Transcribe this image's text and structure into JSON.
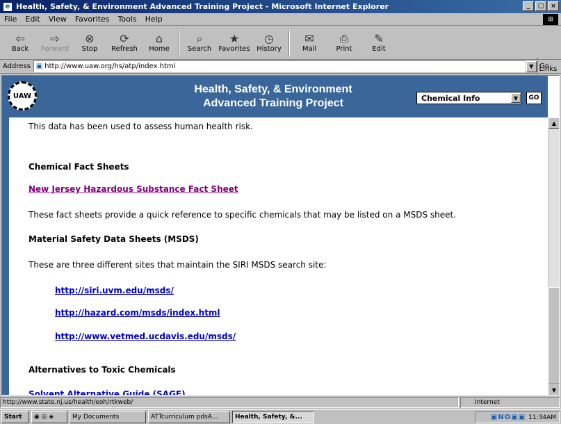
{
  "window": {
    "title": "Health, Safety, & Environment Advanced Training Project - Microsoft Internet Explorer",
    "buttons": [
      "_",
      "□",
      "×"
    ]
  },
  "menu": [
    "File",
    "Edit",
    "View",
    "Favorites",
    "Tools",
    "Help"
  ],
  "toolbar": [
    {
      "label": "Back",
      "icon": "back-arrow-icon",
      "glyph": "⇦"
    },
    {
      "label": "Forward",
      "icon": "forward-arrow-icon",
      "glyph": "⇨"
    },
    {
      "label": "Stop",
      "icon": "stop-icon",
      "glyph": "⊗"
    },
    {
      "label": "Refresh",
      "icon": "refresh-icon",
      "glyph": "⟳"
    },
    {
      "label": "Home",
      "icon": "home-icon",
      "glyph": "⌂"
    },
    {
      "label": "Search",
      "icon": "search-icon",
      "glyph": "⌕"
    },
    {
      "label": "Favorites",
      "icon": "favorites-icon",
      "glyph": "★"
    },
    {
      "label": "History",
      "icon": "history-icon",
      "glyph": "◷"
    },
    {
      "label": "Mail",
      "icon": "mail-icon",
      "glyph": "✉"
    },
    {
      "label": "Print",
      "icon": "print-icon",
      "glyph": "⎙"
    },
    {
      "label": "Edit",
      "icon": "edit-icon",
      "glyph": "✎"
    }
  ],
  "links_label": "Links",
  "address": {
    "label": "Address",
    "url": "http://www.uaw.org/hs/atp/index.html",
    "go": "Go"
  },
  "banner": {
    "logo_text": "UAW",
    "heading_line1": "Health, Safety, & Environment",
    "heading_line2": "Advanced Training Project",
    "select_value": "Chemical Info",
    "go_label": "GO",
    "color": "#3a6699"
  },
  "content": {
    "intro": "This data has been used to assess human health risk.",
    "section1_heading": "Chemical Fact Sheets",
    "section1_link": "New Jersey Hazardous Substance Fact Sheet",
    "section1_desc": "These fact sheets provide a quick reference to specific chemicals that may be listed on a MSDS sheet.",
    "section2_heading": "Material Safety Data Sheets (MSDS)",
    "section2_desc": "These are three different sites that maintain the SIRI MSDS search site:",
    "msds_links": [
      "http://siri.uvm.edu/msds/",
      "http://hazard.com/msds/index.html",
      "http://www.vetmed.ucdavis.edu/msds/"
    ],
    "section3_heading": "Alternatives to Toxic Chemicals",
    "section3_link": "Solvent Alternative Guide (SAGE)"
  },
  "status": {
    "url": "http://www.state.nj.us/health/eoh/rtkweb/",
    "zone": "Internet"
  },
  "taskbar": {
    "start": "Start",
    "buttons": [
      "My Documents",
      "ATTcurriculum pdsA...",
      "Health, Safety, &..."
    ],
    "clock": "11:34AM"
  }
}
